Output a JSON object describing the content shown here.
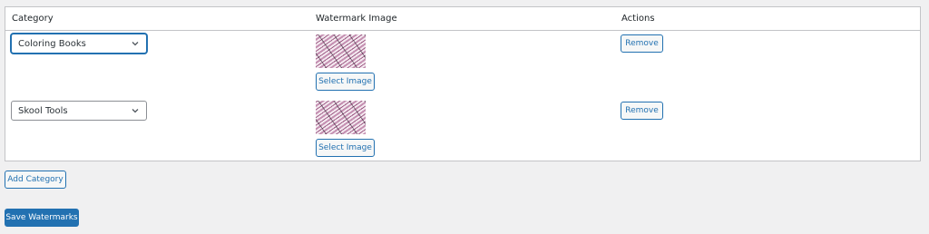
{
  "table": {
    "headers": {
      "category": "Category",
      "watermark_image": "Watermark Image",
      "actions": "Actions"
    },
    "rows": [
      {
        "category": "Coloring Books",
        "select_image_label": "Select Image",
        "remove_label": "Remove"
      },
      {
        "category": "Skool Tools",
        "select_image_label": "Select Image",
        "remove_label": "Remove"
      }
    ]
  },
  "buttons": {
    "add_category": "Add Category",
    "save_watermarks": "Save Watermarks"
  },
  "icons": {
    "dropdown": "chevron-down-icon"
  },
  "colors": {
    "accent": "#2271b1",
    "background": "#f0f0f1",
    "border": "#c3c4c7"
  }
}
